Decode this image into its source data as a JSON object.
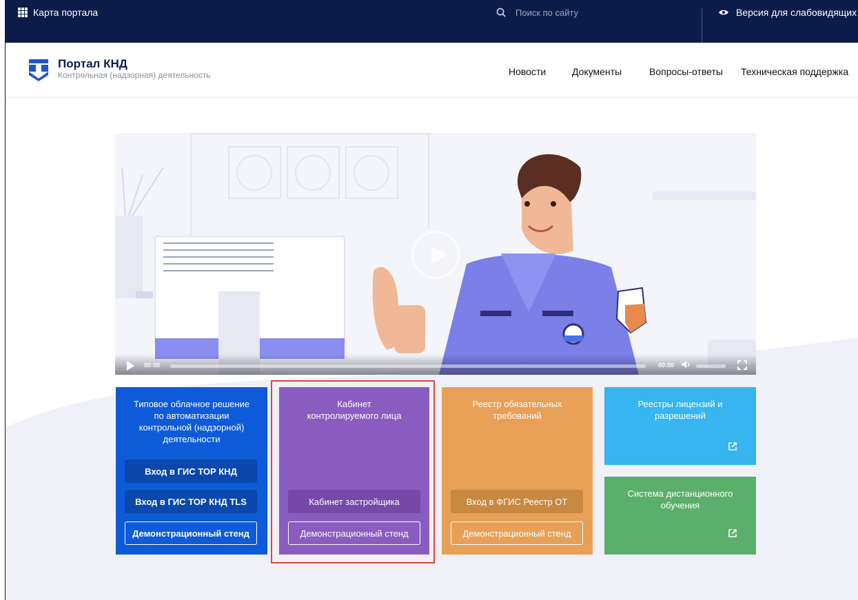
{
  "topbar": {
    "map_label": "Карта портала",
    "search_placeholder": "Поиск по сайту",
    "vision_label": "Версия для слабовидящих"
  },
  "header": {
    "logo_title": "Портал КНД",
    "logo_subtitle": "Контрольная (надзорная) деятельность",
    "nav": [
      "Новости",
      "Документы",
      "Вопросы-ответы",
      "Техническая поддержка"
    ]
  },
  "video": {
    "current_time": "00:00",
    "duration": "00:00"
  },
  "cards": {
    "tor": {
      "title": "Типовое облачное решение по автоматизации контрольной (надзорной) деятельности",
      "btn1": "Вход в ГИС ТОР КНД",
      "btn2": "Вход в ГИС ТОР КНД TLS",
      "btn3": "Демонстрационный стенд",
      "color": "#0d5bd8"
    },
    "cabinet": {
      "title": "Кабинет контролируемого лица",
      "btn1": "Кабинет застройщика",
      "btn2": "Демонстрационный стенд",
      "color": "#8b5cc0"
    },
    "registry": {
      "title": "Реестр обязательных требований",
      "btn1": "Вход в ФГИС Реестр ОТ",
      "btn2": "Демонстрационный стенд",
      "color": "#e8a057"
    },
    "licenses": {
      "title": "Реестры лицензий и разрешений",
      "color": "#36b5f0"
    },
    "learning": {
      "title": "Система дистанционного обучения",
      "color": "#5aaf6a"
    }
  }
}
